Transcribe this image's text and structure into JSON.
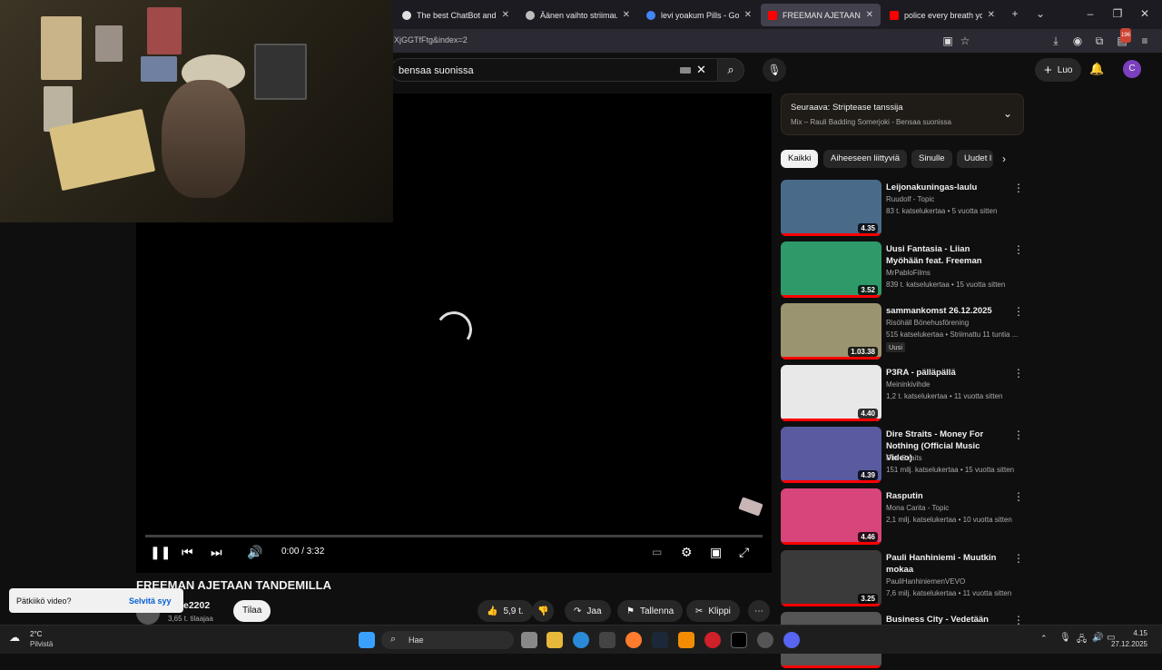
{
  "browser": {
    "tabs": [
      {
        "title": "The best ChatBot and Widg",
        "color": "#e0e0e0"
      },
      {
        "title": "Äänen vaihto striimauksessa",
        "color": "#bdbdbd"
      },
      {
        "title": "levi yoakum Pills - Google-h",
        "color": "#4285f4"
      },
      {
        "title": "FREEMAN AJETAAN TANDEM",
        "color": "#ff0000"
      },
      {
        "title": "police every breath you tak",
        "color": "#ff0000"
      }
    ],
    "url": "XjGGTfFtg&index=2",
    "downloads_badge": "196"
  },
  "youtube": {
    "search_value": "bensaa suonissa",
    "create_label": "Luo",
    "avatar_letter": "C",
    "player": {
      "time": "0:00 / 3:32"
    },
    "video": {
      "title": "FREEMAN AJETAAN TANDEMILLA",
      "channel": "e2202",
      "subscribers": "3,65 t. tilaajaa",
      "subscribe_label": "Tilaa",
      "likes": "5,9 t.",
      "share_label": "Jaa",
      "save_label": "Tallenna",
      "clip_label": "Klippi"
    },
    "toast": {
      "question": "Pätkiikö video?",
      "action": "Selvitä syy"
    },
    "up_next": {
      "label": "Seuraava:",
      "title": "Striptease tanssija",
      "subtitle": "Mix – Rauli Badding Somerjoki - Bensaa suonissa"
    },
    "chips": [
      "Kaikki",
      "Aiheeseen liittyviä",
      "Sinulle",
      "Uudet l"
    ],
    "recommendations": [
      {
        "title": "Leijonakuningas-laulu",
        "channel": "Ruudolf - Topic",
        "meta": "83 t. katselukertaa • 5 vuotta sitten",
        "duration": "4.35",
        "thumb": "#4a6a8a"
      },
      {
        "title": "Uusi Fantasia - Liian Myöhään feat. Freeman",
        "channel": "MrPabloFilms",
        "meta": "839 t. katselukertaa • 15 vuotta sitten",
        "duration": "3.52",
        "thumb": "#2e9a6a"
      },
      {
        "title": "sammankomst 26.12.2025",
        "channel": "Risöhäll Bönehusförening",
        "meta": "515 katselukertaa • Striimattu 11 tuntia ...",
        "badge": "Uusi",
        "duration": "1.03.38",
        "thumb": "#9a9470"
      },
      {
        "title": "P3RA - pälläpällä",
        "channel": "Meininkivihde",
        "meta": "1,2 t. katselukertaa • 11 vuotta sitten",
        "duration": "4.40",
        "thumb": "#e8e8e8"
      },
      {
        "title": "Dire Straits - Money For Nothing (Official Music Video)",
        "channel": "Dire Straits",
        "meta": "151 milj. katselukertaa • 15 vuotta sitten",
        "duration": "4.39",
        "thumb": "#5a5aa0"
      },
      {
        "title": "Rasputin",
        "channel": "Mona Carita - Topic",
        "meta": "2,1 milj. katselukertaa • 10 vuotta sitten",
        "duration": "4.46",
        "thumb": "#d8457a"
      },
      {
        "title": "Pauli Hanhiniemi - Muutkin mokaa",
        "channel": "PauliHanhiniemenVEVO",
        "meta": "7,6 milj. katselukertaa • 11 vuotta sitten",
        "duration": "3.25",
        "thumb": "#3a3a3a"
      },
      {
        "title": "Business City - Vedetään",
        "channel": "",
        "meta": "",
        "duration": "",
        "thumb": "#555"
      }
    ]
  },
  "taskbar": {
    "temperature": "2°C",
    "weather": "Pilvistä",
    "search_placeholder": "Hae",
    "time": "4.15",
    "date": "27.12.2025"
  }
}
